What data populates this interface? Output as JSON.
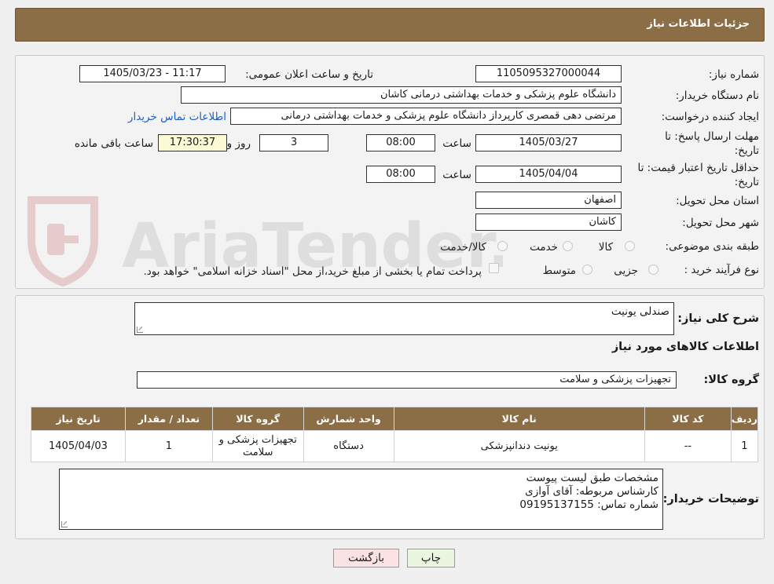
{
  "header": {
    "title": "جزئیات اطلاعات نیاز"
  },
  "watermark": {
    "text": "AriaTender.neT"
  },
  "fields": {
    "need_number_label": "شماره نیاز:",
    "need_number": "1105095327000044",
    "announce_label": "تاریخ و ساعت اعلان عمومی:",
    "announce_value": "1405/03/23 - 11:17",
    "buyer_org_label": "نام دستگاه خریدار:",
    "buyer_org": "دانشگاه علوم پزشکی و خدمات بهداشتی درمانی کاشان",
    "requester_label": "ایجاد کننده درخواست:",
    "requester": "مرتضی دهی قمصری کارپرداز دانشگاه علوم پزشکی و خدمات بهداشتی درمانی",
    "contact_link": "اطلاعات تماس خریدار",
    "deadline_label": "مهلت ارسال پاسخ: تا تاریخ:",
    "deadline_date": "1405/03/27",
    "time_label": "ساعت",
    "deadline_time": "08:00",
    "days_value": "3",
    "days_label": "روز و",
    "remaining_time": "17:30:37",
    "remaining_label": "ساعت باقی مانده",
    "validity_label": "حداقل تاریخ اعتبار قیمت: تا تاریخ:",
    "validity_date": "1405/04/04",
    "validity_time": "08:00",
    "province_label": "استان محل تحویل:",
    "province": "اصفهان",
    "city_label": "شهر محل تحویل:",
    "city": "کاشان",
    "category_label": "طبقه بندی موضوعی:",
    "category_options": [
      "کالا",
      "خدمت",
      "کالا/خدمت"
    ],
    "process_label": "نوع فرآیند خرید :",
    "process_options": [
      "جزیی",
      "متوسط"
    ],
    "payment_note": "پرداخت تمام یا بخشی از مبلغ خرید،از محل \"اسناد خزانه اسلامی\" خواهد بود."
  },
  "summary": {
    "description_label": "شرح کلی نیاز:",
    "description": "صندلی یونیت",
    "goods_info_title": "اطلاعات کالاهای مورد نیاز",
    "goods_group_label": "گروه کالا:",
    "goods_group": "تجهیزات پزشکی و سلامت"
  },
  "table": {
    "headers": [
      "ردیف",
      "کد کالا",
      "نام کالا",
      "واحد شمارش",
      "گروه کالا",
      "تعداد / مقدار",
      "تاریخ نیاز"
    ],
    "rows": [
      [
        "1",
        "--",
        "یونیت دندانپزشکی",
        "دستگاه",
        "تجهیزات پزشکی و سلامت",
        "1",
        "1405/04/03"
      ]
    ]
  },
  "buyer_notes": {
    "label": "توضیحات خریدار:",
    "line1": "مشخصات طبق لیست پیوست",
    "line2": "کارشناس مربوطه: آقای آوازی",
    "line3": "شماره تماس: 09195137155"
  },
  "buttons": {
    "print": "چاپ",
    "back": "بازگشت"
  },
  "colors": {
    "header_bg": "#8b6e45",
    "back_button": "#fbe3e3",
    "print_button": "#e9f7e0",
    "link": "#1b5fc8"
  }
}
